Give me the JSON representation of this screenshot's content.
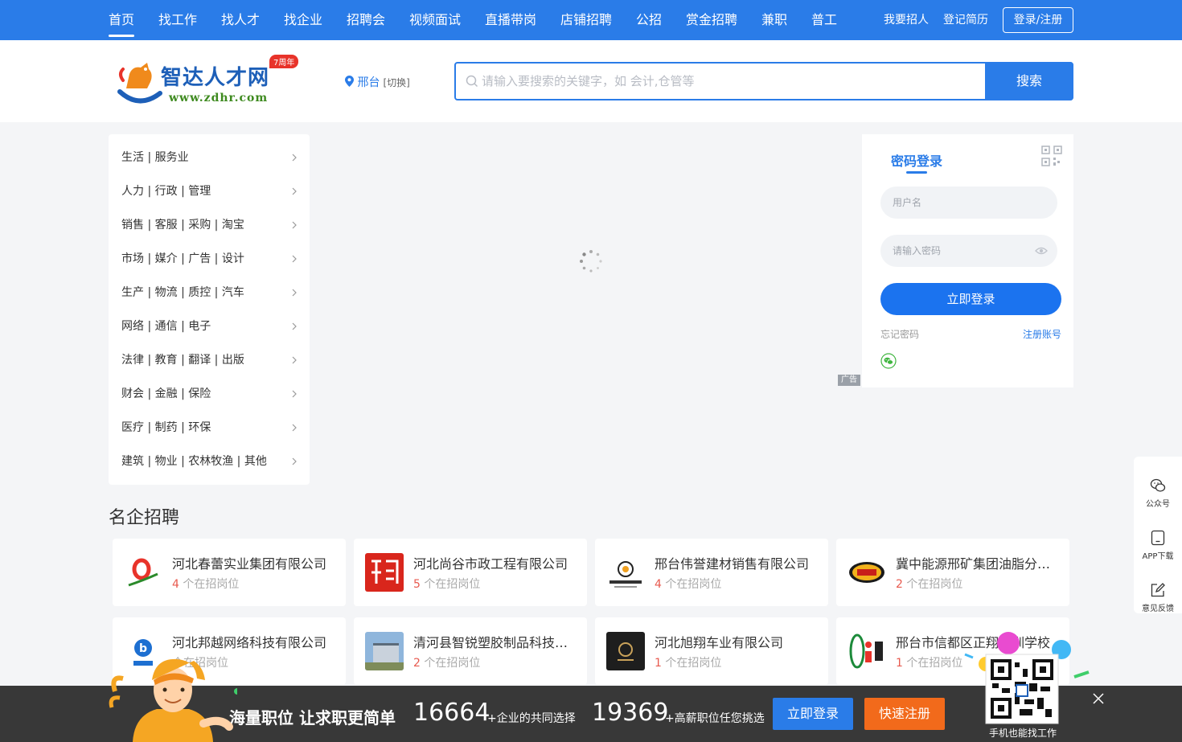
{
  "nav": {
    "items": [
      "首页",
      "找工作",
      "找人才",
      "找企业",
      "招聘会",
      "视频面试",
      "直播带岗",
      "店铺招聘",
      "公招",
      "赏金招聘",
      "兼职",
      "普工"
    ],
    "post_job": "我要招人",
    "post_resume": "登记简历",
    "login_register": "登录/注册"
  },
  "header": {
    "logo_text": "智达人才网",
    "logo_url": "www.zdhr.com",
    "logo_badge": "7周年",
    "city": "邢台",
    "city_switch": "[切换]",
    "search_placeholder": "请输入要搜索的关键字，如 会计,仓管等",
    "search_button": "搜索"
  },
  "categories": [
    "生活 | 服务业",
    "人力 | 行政 | 管理",
    "销售 | 客服 | 采购 | 淘宝",
    "市场 | 媒介 | 广告 | 设计",
    "生产 | 物流 | 质控 | 汽车",
    "网络 | 通信 | 电子",
    "法律 | 教育 | 翻译 | 出版",
    "财会 | 金融 | 保险",
    "医疗 | 制药 | 环保",
    "建筑 | 物业 | 农林牧渔 | 其他"
  ],
  "banner": {
    "ad_tag": "广告"
  },
  "login": {
    "title": "密码登录",
    "username_placeholder": "用户名",
    "password_placeholder": "请输入密码",
    "submit": "立即登录",
    "forgot": "忘记密码",
    "register": "注册账号"
  },
  "side": {
    "wechat": "公众号",
    "app": "APP下载",
    "feedback": "意见反馈"
  },
  "companies_section": {
    "title": "名企招聘",
    "jobs_suffix": "个在招岗位",
    "items": [
      {
        "name": "河北春蕾实业集团有限公司",
        "jobs": "4"
      },
      {
        "name": "河北尚谷市政工程有限公司",
        "jobs": "5"
      },
      {
        "name": "邢台伟誉建材销售有限公司",
        "jobs": "4"
      },
      {
        "name": "冀中能源邢矿集团油脂分公司",
        "jobs": "2"
      },
      {
        "name": "河北邦越网络科技有限公司",
        "jobs": ""
      },
      {
        "name": "清河县智锐塑胶制品科技有限公司",
        "jobs": "2"
      },
      {
        "name": "河北旭翔车业有限公司",
        "jobs": "1"
      },
      {
        "name": "邢台市信都区正翔培训学校",
        "jobs": "1"
      }
    ]
  },
  "bottom_bar": {
    "slogan": "海量职位 让求职更简单",
    "company_count": "16664",
    "company_note": "+企业的共同选择",
    "job_count": "19369",
    "job_note": "+高薪职位任您挑选",
    "login": "立即登录",
    "register": "快速注册",
    "qr_caption": "手机也能找工作"
  }
}
